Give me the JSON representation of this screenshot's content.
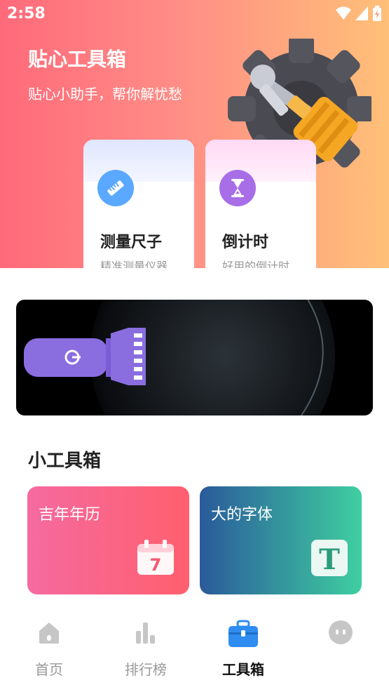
{
  "status": {
    "time": "2:58"
  },
  "hero": {
    "title": "贴心工具箱",
    "subtitle": "贴心小助手，帮你解忧愁"
  },
  "feature_cards": [
    {
      "title": "测量尺子",
      "subtitle": "精准测量仪器",
      "icon": "ruler-icon",
      "color": "#5aa8ff"
    },
    {
      "title": "倒计时",
      "subtitle": "好用的倒计时",
      "icon": "hourglass-icon",
      "color": "#a86ee8"
    }
  ],
  "section": {
    "title": "小工具箱"
  },
  "tools": [
    {
      "label": "吉年年历",
      "icon": "calendar-icon"
    },
    {
      "label": "大的字体",
      "icon": "font-icon"
    }
  ],
  "tabs": [
    {
      "label": "首页",
      "icon": "home-icon"
    },
    {
      "label": "排行榜",
      "icon": "chart-icon"
    },
    {
      "label": "工具箱",
      "icon": "toolbox-icon",
      "active": true
    },
    {
      "label": "",
      "icon": "profile-icon"
    }
  ],
  "colors": {
    "accent": "#2f8cf0",
    "hero_start": "#ff6a7a",
    "hero_end": "#ffc078"
  }
}
